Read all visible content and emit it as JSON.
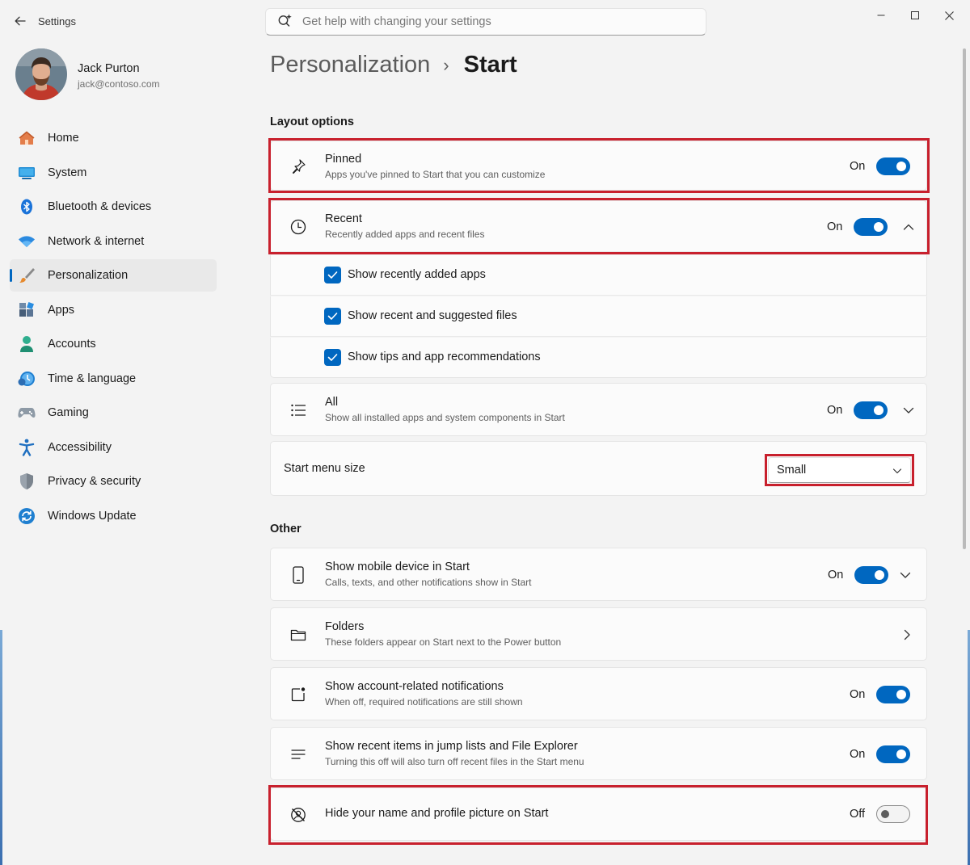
{
  "window": {
    "title": "Settings",
    "controls": [
      "minimize",
      "maximize",
      "close"
    ]
  },
  "search": {
    "placeholder": "Get help with changing your settings",
    "icon": "sparkle-search-icon"
  },
  "user": {
    "name": "Jack Purton",
    "email": "jack@contoso.com"
  },
  "sidebar": {
    "items": [
      {
        "label": "Home",
        "icon": "home-icon",
        "active": false
      },
      {
        "label": "System",
        "icon": "system-icon",
        "active": false
      },
      {
        "label": "Bluetooth & devices",
        "icon": "bluetooth-icon",
        "active": false
      },
      {
        "label": "Network & internet",
        "icon": "wifi-icon",
        "active": false
      },
      {
        "label": "Personalization",
        "icon": "brush-icon",
        "active": true
      },
      {
        "label": "Apps",
        "icon": "apps-icon",
        "active": false
      },
      {
        "label": "Accounts",
        "icon": "accounts-icon",
        "active": false
      },
      {
        "label": "Time & language",
        "icon": "time-language-icon",
        "active": false
      },
      {
        "label": "Gaming",
        "icon": "gamepad-icon",
        "active": false
      },
      {
        "label": "Accessibility",
        "icon": "accessibility-icon",
        "active": false
      },
      {
        "label": "Privacy & security",
        "icon": "shield-icon",
        "active": false
      },
      {
        "label": "Windows Update",
        "icon": "update-icon",
        "active": false
      }
    ]
  },
  "breadcrumb": {
    "parent": "Personalization",
    "separator": "›",
    "current": "Start"
  },
  "layout_options": {
    "heading": "Layout options",
    "pinned": {
      "title": "Pinned",
      "subtitle": "Apps you've pinned to Start that you can customize",
      "state": "On"
    },
    "recent": {
      "title": "Recent",
      "subtitle": "Recently added apps and recent files",
      "state": "On",
      "options": [
        {
          "label": "Show recently added apps",
          "checked": true
        },
        {
          "label": "Show recent and suggested files",
          "checked": true
        },
        {
          "label": "Show tips and app recommendations",
          "checked": true
        }
      ]
    },
    "all": {
      "title": "All",
      "subtitle": "Show all installed apps and system components in Start",
      "state": "On"
    },
    "size": {
      "label": "Start menu size",
      "value": "Small"
    }
  },
  "other": {
    "heading": "Other",
    "mobile": {
      "title": "Show mobile device in Start",
      "subtitle": "Calls, texts, and other notifications show in Start",
      "state": "On"
    },
    "folders": {
      "title": "Folders",
      "subtitle": "These folders appear on Start next to the Power button"
    },
    "account_notifications": {
      "title": "Show account-related notifications",
      "subtitle": "When off, required notifications are still shown",
      "state": "On"
    },
    "jump_lists": {
      "title": "Show recent items in jump lists and File Explorer",
      "subtitle": "Turning this off will also turn off recent files in the Start menu",
      "state": "On"
    },
    "hide_profile": {
      "title": "Hide your name and profile picture on Start",
      "state": "Off"
    }
  },
  "colors": {
    "accent": "#0067c0",
    "highlight": "#c8202d",
    "background": "#f3f3f3",
    "card": "#fbfbfb"
  }
}
